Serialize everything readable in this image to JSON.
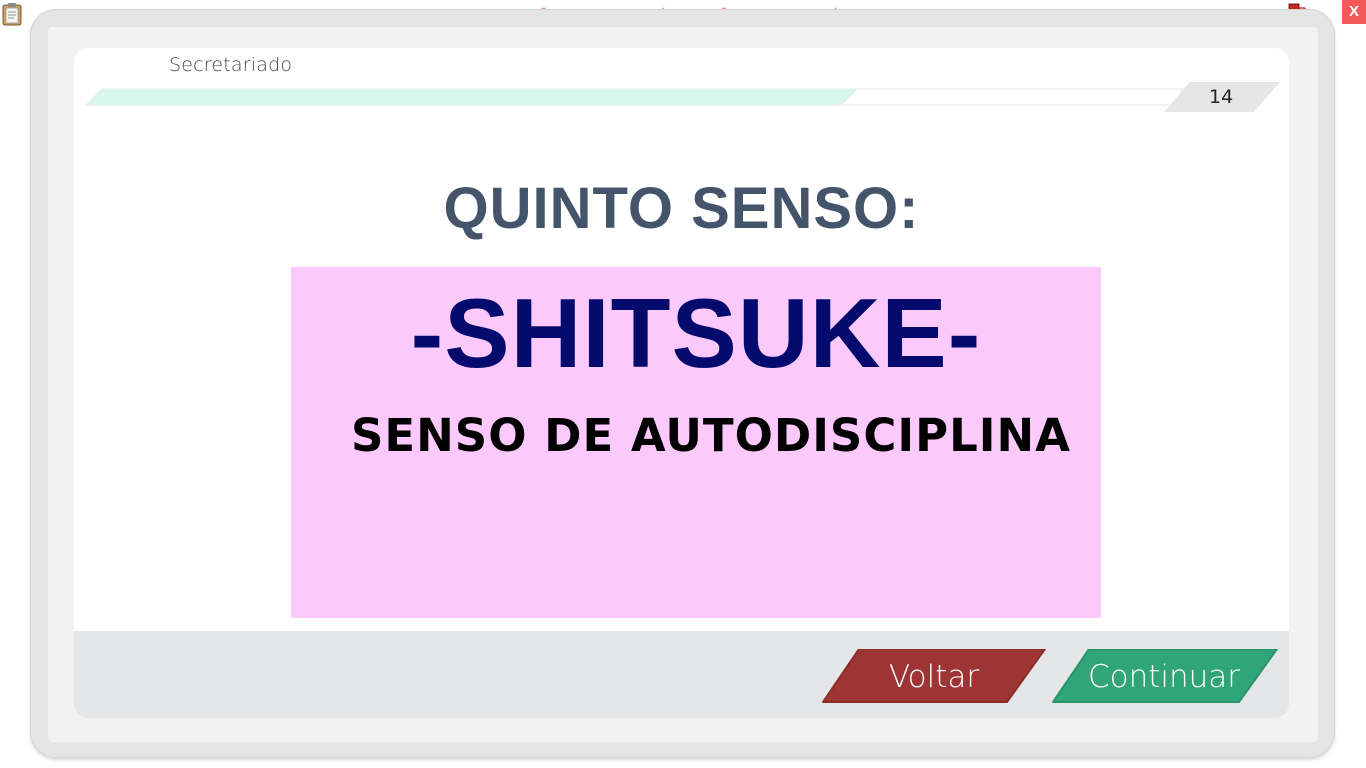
{
  "app": {
    "banner": "VERSÃO PARA FUNCIONÁRIOS - NÃO COMERCIALIZÁVEL",
    "close_label": "X",
    "icons": [
      "clipboard-icon",
      "network-status-icon"
    ]
  },
  "header": {
    "course_title": "Secretariado",
    "page_number": "14",
    "progress_fraction": 0.7
  },
  "slide": {
    "heading": "QUINTO SENSO:",
    "term": "-SHITSUKE-",
    "meaning": "SENSO DE AUTODISCIPLINA"
  },
  "footer": {
    "back_label": "Voltar",
    "next_label": "Continuar"
  },
  "colors": {
    "heading": "#44546a",
    "term": "#050a6e",
    "pink_panel": "#fbc9fc",
    "progress_fill": "#d8f6ec",
    "back_button": "#9e3535",
    "next_button": "#31a57a",
    "close_button": "#f25a5a",
    "banner_text": "#f0606a"
  }
}
